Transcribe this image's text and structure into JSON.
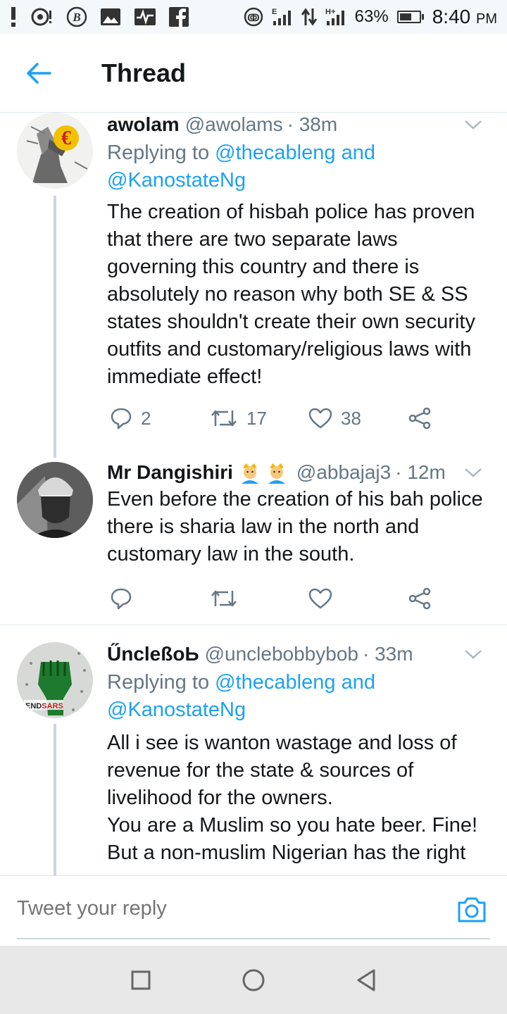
{
  "status_bar": {
    "icons": [
      "alert-icon",
      "notification-icon",
      "b-icon",
      "image-icon",
      "pulse-icon",
      "facebook-icon",
      "signal-e-icon",
      "data-arrows-icon",
      "signal-h-icon"
    ],
    "battery_percent": "63%",
    "battery_level": 0.63,
    "time": "8:40",
    "ampm": "PM",
    "sim1_label": "E",
    "sim2_label": "H+"
  },
  "header": {
    "title": "Thread"
  },
  "tweets": [
    {
      "name": "awolam",
      "handle": "@awolams",
      "time": "· 38m",
      "replying_prefix": "Replying to",
      "mention1": "@thecableng",
      "and": "and",
      "mention2": "@KanostateNg",
      "text": "The creation of hisbah police has proven that there are two separate laws governing this country and there is absolutely no reason why both SE & SS states shouldn't create their own security outfits and customary/religious laws with immediate effect!",
      "replies": "2",
      "retweets": "17",
      "likes": "38"
    },
    {
      "name": "Mr Dangishiri",
      "emoji": "👳👳",
      "handle": "@abbajaj3",
      "time": "· 12m",
      "text": "Even before the creation of his bah police there is sharia law in the north and customary law in the south."
    },
    {
      "name": "ŰncleßoЬ",
      "handle": "@unclebobbybob",
      "time": "· 33m",
      "replying_prefix": "Replying to",
      "mention1": "@thecableng",
      "and": "and",
      "mention2": "@KanostateNg",
      "avatar_text": "ENDSARS",
      "text": "All i see is wanton wastage and loss of revenue for the state & sources of livelihood for the owners.\nYou are a Muslim so you hate beer. Fine! But a non-muslim Nigerian has the right"
    }
  ],
  "reply_bar": {
    "placeholder": "Tweet your reply"
  },
  "colors": {
    "accent": "#1da1f2",
    "secondary_text": "#657786",
    "divider": "#e1e8ed"
  }
}
